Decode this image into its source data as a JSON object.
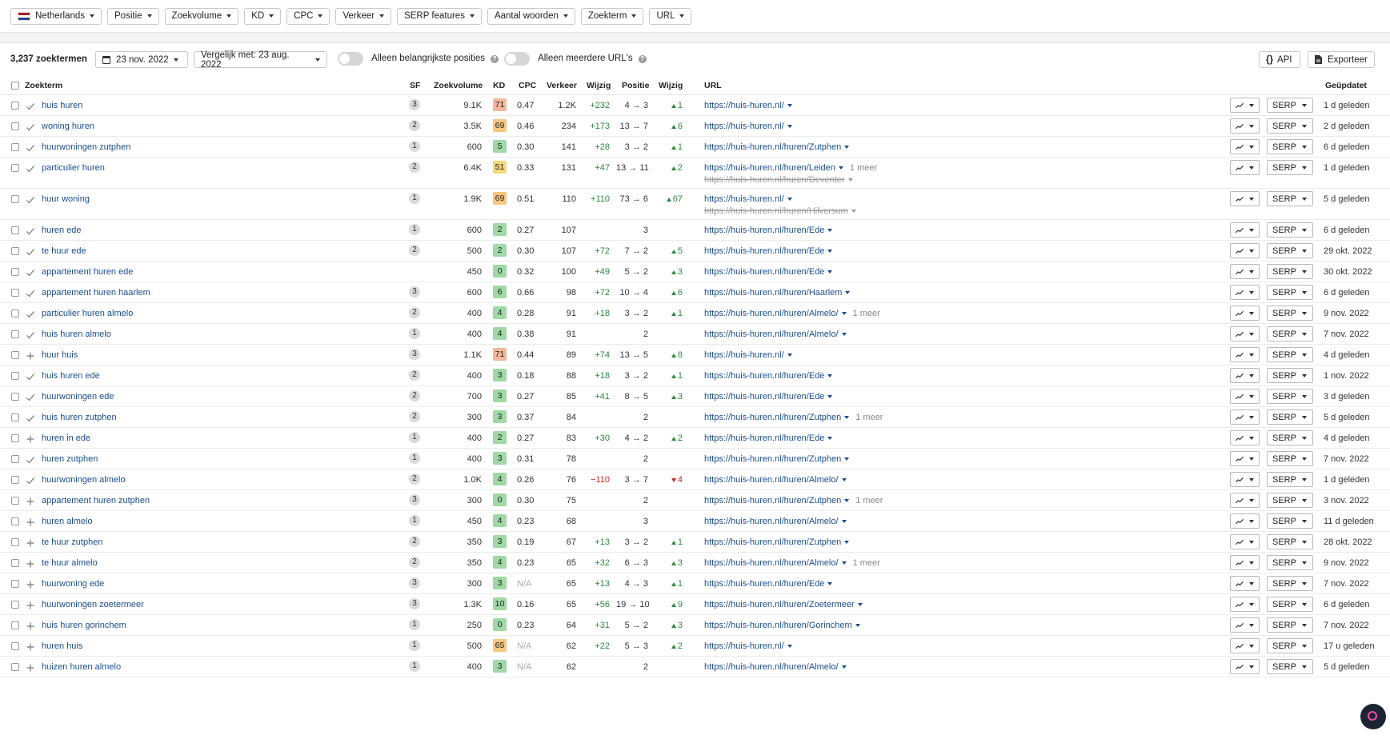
{
  "filters": {
    "country": "Netherlands",
    "items": [
      "Positie",
      "Zoekvolume",
      "KD",
      "CPC",
      "Verkeer",
      "SERP features",
      "Aantal woorden",
      "Zoekterm",
      "URL"
    ]
  },
  "toolbar": {
    "count": "3,237 zoektermen",
    "date": "23 nov. 2022",
    "compare": "Vergelijk met: 23 aug. 2022",
    "toggle1": "Alleen belangrijkste posities",
    "toggle2": "Alleen meerdere URL's",
    "api": "API",
    "export": "Exporteer"
  },
  "headers": {
    "keyword": "Zoekterm",
    "sf": "SF",
    "volume": "Zoekvolume",
    "kd": "KD",
    "cpc": "CPC",
    "traffic": "Verkeer",
    "change": "Wijzig",
    "position": "Positie",
    "pos_change": "Wijzig",
    "url": "URL",
    "updated": "Geüpdatet"
  },
  "serp_label": "SERP",
  "colors": {
    "kd_red": "#f4b79b",
    "kd_orange": "#f6c77e",
    "kd_yellow": "#f7d77d",
    "kd_green": "#9fd9a5",
    "link": "#1a4e8f",
    "up": "#2c8a3c",
    "down": "#c62828"
  },
  "rows": [
    {
      "kw": "huis huren",
      "icon": "check",
      "sf": "3",
      "vol": "9.1K",
      "kd": "71",
      "kdc": "#f4b79b",
      "cpc": "0.47",
      "traf": "1.2K",
      "chg": "+232",
      "chgc": "pos",
      "pos": "4 → 3",
      "pc": "1",
      "pcd": "up",
      "url": "https://huis-huren.nl/",
      "more": "",
      "url2": "",
      "upd": "1 d geleden"
    },
    {
      "kw": "woning huren",
      "icon": "check",
      "sf": "2",
      "vol": "3.5K",
      "kd": "69",
      "kdc": "#f6c77e",
      "cpc": "0.46",
      "traf": "234",
      "chg": "+173",
      "chgc": "pos",
      "pos": "13 → 7",
      "pc": "6",
      "pcd": "up",
      "url": "https://huis-huren.nl/",
      "more": "",
      "url2": "",
      "upd": "2 d geleden"
    },
    {
      "kw": "huurwoningen zutphen",
      "icon": "check",
      "sf": "1",
      "vol": "600",
      "kd": "5",
      "kdc": "#9fd9a5",
      "cpc": "0.30",
      "traf": "141",
      "chg": "+28",
      "chgc": "pos",
      "pos": "3 → 2",
      "pc": "1",
      "pcd": "up",
      "url": "https://huis-huren.nl/huren/Zutphen",
      "more": "",
      "url2": "",
      "upd": "6 d geleden"
    },
    {
      "kw": "particulier huren",
      "icon": "check",
      "sf": "2",
      "vol": "6.4K",
      "kd": "51",
      "kdc": "#f7d77d",
      "cpc": "0.33",
      "traf": "131",
      "chg": "+47",
      "chgc": "pos",
      "pos": "13 → 11",
      "pc": "2",
      "pcd": "up",
      "url": "https://huis-huren.nl/huren/Leiden",
      "more": "1 meer",
      "url2": "https://huis-huren.nl/huren/Deventer",
      "upd": "1 d geleden"
    },
    {
      "kw": "huur woning",
      "icon": "check",
      "sf": "1",
      "vol": "1.9K",
      "kd": "69",
      "kdc": "#f6c77e",
      "cpc": "0.51",
      "traf": "110",
      "chg": "+110",
      "chgc": "pos",
      "pos": "73 → 6",
      "pc": "67",
      "pcd": "up",
      "url": "https://huis-huren.nl/",
      "more": "",
      "url2": "https://huis-huren.nl/huren/Hilversum",
      "upd": "5 d geleden"
    },
    {
      "kw": "huren ede",
      "icon": "check",
      "sf": "1",
      "vol": "600",
      "kd": "2",
      "kdc": "#9fd9a5",
      "cpc": "0.27",
      "traf": "107",
      "chg": "",
      "chgc": "",
      "pos": "3",
      "pc": "",
      "pcd": "",
      "url": "https://huis-huren.nl/huren/Ede",
      "more": "",
      "url2": "",
      "upd": "6 d geleden"
    },
    {
      "kw": "te huur ede",
      "icon": "check",
      "sf": "2",
      "vol": "500",
      "kd": "2",
      "kdc": "#9fd9a5",
      "cpc": "0.30",
      "traf": "107",
      "chg": "+72",
      "chgc": "pos",
      "pos": "7 → 2",
      "pc": "5",
      "pcd": "up",
      "url": "https://huis-huren.nl/huren/Ede",
      "more": "",
      "url2": "",
      "upd": "29 okt. 2022"
    },
    {
      "kw": "appartement huren ede",
      "icon": "check",
      "sf": "",
      "vol": "450",
      "kd": "0",
      "kdc": "#9fd9a5",
      "cpc": "0.32",
      "traf": "100",
      "chg": "+49",
      "chgc": "pos",
      "pos": "5 → 2",
      "pc": "3",
      "pcd": "up",
      "url": "https://huis-huren.nl/huren/Ede",
      "more": "",
      "url2": "",
      "upd": "30 okt. 2022"
    },
    {
      "kw": "appartement huren haarlem",
      "icon": "check",
      "sf": "3",
      "vol": "600",
      "kd": "6",
      "kdc": "#9fd9a5",
      "cpc": "0.66",
      "traf": "98",
      "chg": "+72",
      "chgc": "pos",
      "pos": "10 → 4",
      "pc": "6",
      "pcd": "up",
      "url": "https://huis-huren.nl/huren/Haarlem",
      "more": "",
      "url2": "",
      "upd": "6 d geleden"
    },
    {
      "kw": "particulier huren almelo",
      "icon": "check",
      "sf": "2",
      "vol": "400",
      "kd": "4",
      "kdc": "#9fd9a5",
      "cpc": "0.28",
      "traf": "91",
      "chg": "+18",
      "chgc": "pos",
      "pos": "3 → 2",
      "pc": "1",
      "pcd": "up",
      "url": "https://huis-huren.nl/huren/Almelo/",
      "more": "1 meer",
      "url2": "",
      "upd": "9 nov. 2022"
    },
    {
      "kw": "huis huren almelo",
      "icon": "check",
      "sf": "1",
      "vol": "400",
      "kd": "4",
      "kdc": "#9fd9a5",
      "cpc": "0.38",
      "traf": "91",
      "chg": "",
      "chgc": "",
      "pos": "2",
      "pc": "",
      "pcd": "",
      "url": "https://huis-huren.nl/huren/Almelo/",
      "more": "",
      "url2": "",
      "upd": "7 nov. 2022"
    },
    {
      "kw": "huur huis",
      "icon": "plus",
      "sf": "3",
      "vol": "1.1K",
      "kd": "71",
      "kdc": "#f4b79b",
      "cpc": "0.44",
      "traf": "89",
      "chg": "+74",
      "chgc": "pos",
      "pos": "13 → 5",
      "pc": "8",
      "pcd": "up",
      "url": "https://huis-huren.nl/",
      "more": "",
      "url2": "",
      "upd": "4 d geleden"
    },
    {
      "kw": "huis huren ede",
      "icon": "check",
      "sf": "2",
      "vol": "400",
      "kd": "3",
      "kdc": "#9fd9a5",
      "cpc": "0.18",
      "traf": "88",
      "chg": "+18",
      "chgc": "pos",
      "pos": "3 → 2",
      "pc": "1",
      "pcd": "up",
      "url": "https://huis-huren.nl/huren/Ede",
      "more": "",
      "url2": "",
      "upd": "1 nov. 2022"
    },
    {
      "kw": "huurwoningen ede",
      "icon": "check",
      "sf": "2",
      "vol": "700",
      "kd": "3",
      "kdc": "#9fd9a5",
      "cpc": "0.27",
      "traf": "85",
      "chg": "+41",
      "chgc": "pos",
      "pos": "8 → 5",
      "pc": "3",
      "pcd": "up",
      "url": "https://huis-huren.nl/huren/Ede",
      "more": "",
      "url2": "",
      "upd": "3 d geleden"
    },
    {
      "kw": "huis huren zutphen",
      "icon": "check",
      "sf": "2",
      "vol": "300",
      "kd": "3",
      "kdc": "#9fd9a5",
      "cpc": "0.37",
      "traf": "84",
      "chg": "",
      "chgc": "",
      "pos": "2",
      "pc": "",
      "pcd": "",
      "url": "https://huis-huren.nl/huren/Zutphen",
      "more": "1 meer",
      "url2": "",
      "upd": "5 d geleden"
    },
    {
      "kw": "huren in ede",
      "icon": "plus",
      "sf": "1",
      "vol": "400",
      "kd": "2",
      "kdc": "#9fd9a5",
      "cpc": "0.27",
      "traf": "83",
      "chg": "+30",
      "chgc": "pos",
      "pos": "4 → 2",
      "pc": "2",
      "pcd": "up",
      "url": "https://huis-huren.nl/huren/Ede",
      "more": "",
      "url2": "",
      "upd": "4 d geleden"
    },
    {
      "kw": "huren zutphen",
      "icon": "check",
      "sf": "1",
      "vol": "400",
      "kd": "3",
      "kdc": "#9fd9a5",
      "cpc": "0.31",
      "traf": "78",
      "chg": "",
      "chgc": "",
      "pos": "2",
      "pc": "",
      "pcd": "",
      "url": "https://huis-huren.nl/huren/Zutphen",
      "more": "",
      "url2": "",
      "upd": "7 nov. 2022"
    },
    {
      "kw": "huurwoningen almelo",
      "icon": "check",
      "sf": "2",
      "vol": "1.0K",
      "kd": "4",
      "kdc": "#9fd9a5",
      "cpc": "0.26",
      "traf": "76",
      "chg": "−110",
      "chgc": "neg",
      "pos": "3 → 7",
      "pc": "4",
      "pcd": "down",
      "url": "https://huis-huren.nl/huren/Almelo/",
      "more": "",
      "url2": "",
      "upd": "1 d geleden"
    },
    {
      "kw": "appartement huren zutphen",
      "icon": "plus",
      "sf": "3",
      "vol": "300",
      "kd": "0",
      "kdc": "#9fd9a5",
      "cpc": "0.30",
      "traf": "75",
      "chg": "",
      "chgc": "",
      "pos": "2",
      "pc": "",
      "pcd": "",
      "url": "https://huis-huren.nl/huren/Zutphen",
      "more": "1 meer",
      "url2": "",
      "upd": "3 nov. 2022"
    },
    {
      "kw": "huren almelo",
      "icon": "plus",
      "sf": "1",
      "vol": "450",
      "kd": "4",
      "kdc": "#9fd9a5",
      "cpc": "0.23",
      "traf": "68",
      "chg": "",
      "chgc": "",
      "pos": "3",
      "pc": "",
      "pcd": "",
      "url": "https://huis-huren.nl/huren/Almelo/",
      "more": "",
      "url2": "",
      "upd": "11 d geleden"
    },
    {
      "kw": "te huur zutphen",
      "icon": "plus",
      "sf": "2",
      "vol": "350",
      "kd": "3",
      "kdc": "#9fd9a5",
      "cpc": "0.19",
      "traf": "67",
      "chg": "+13",
      "chgc": "pos",
      "pos": "3 → 2",
      "pc": "1",
      "pcd": "up",
      "url": "https://huis-huren.nl/huren/Zutphen",
      "more": "",
      "url2": "",
      "upd": "28 okt. 2022"
    },
    {
      "kw": "te huur almelo",
      "icon": "plus",
      "sf": "2",
      "vol": "350",
      "kd": "4",
      "kdc": "#9fd9a5",
      "cpc": "0.23",
      "traf": "65",
      "chg": "+32",
      "chgc": "pos",
      "pos": "6 → 3",
      "pc": "3",
      "pcd": "up",
      "url": "https://huis-huren.nl/huren/Almelo/",
      "more": "1 meer",
      "url2": "",
      "upd": "9 nov. 2022"
    },
    {
      "kw": "huurwoning ede",
      "icon": "plus",
      "sf": "3",
      "vol": "300",
      "kd": "3",
      "kdc": "#9fd9a5",
      "cpc": "N/A",
      "traf": "65",
      "chg": "+13",
      "chgc": "pos",
      "pos": "4 → 3",
      "pc": "1",
      "pcd": "up",
      "url": "https://huis-huren.nl/huren/Ede",
      "more": "",
      "url2": "",
      "upd": "7 nov. 2022"
    },
    {
      "kw": "huurwoningen zoetermeer",
      "icon": "plus",
      "sf": "3",
      "vol": "1.3K",
      "kd": "10",
      "kdc": "#9fd9a5",
      "cpc": "0.16",
      "traf": "65",
      "chg": "+56",
      "chgc": "pos",
      "pos": "19 → 10",
      "pc": "9",
      "pcd": "up",
      "url": "https://huis-huren.nl/huren/Zoetermeer",
      "more": "",
      "url2": "",
      "upd": "6 d geleden"
    },
    {
      "kw": "huis huren gorinchem",
      "icon": "plus",
      "sf": "1",
      "vol": "250",
      "kd": "0",
      "kdc": "#9fd9a5",
      "cpc": "0.23",
      "traf": "64",
      "chg": "+31",
      "chgc": "pos",
      "pos": "5 → 2",
      "pc": "3",
      "pcd": "up",
      "url": "https://huis-huren.nl/huren/Gorinchem",
      "more": "",
      "url2": "",
      "upd": "7 nov. 2022"
    },
    {
      "kw": "huren huis",
      "icon": "plus",
      "sf": "1",
      "vol": "500",
      "kd": "65",
      "kdc": "#f6c77e",
      "cpc": "N/A",
      "traf": "62",
      "chg": "+22",
      "chgc": "pos",
      "pos": "5 → 3",
      "pc": "2",
      "pcd": "up",
      "url": "https://huis-huren.nl/",
      "more": "",
      "url2": "",
      "upd": "17 u geleden"
    },
    {
      "kw": "huizen huren almelo",
      "icon": "plus",
      "sf": "1",
      "vol": "400",
      "kd": "3",
      "kdc": "#9fd9a5",
      "cpc": "N/A",
      "traf": "62",
      "chg": "",
      "chgc": "",
      "pos": "2",
      "pc": "",
      "pcd": "",
      "url": "https://huis-huren.nl/huren/Almelo/",
      "more": "",
      "url2": "",
      "upd": "5 d geleden"
    }
  ]
}
